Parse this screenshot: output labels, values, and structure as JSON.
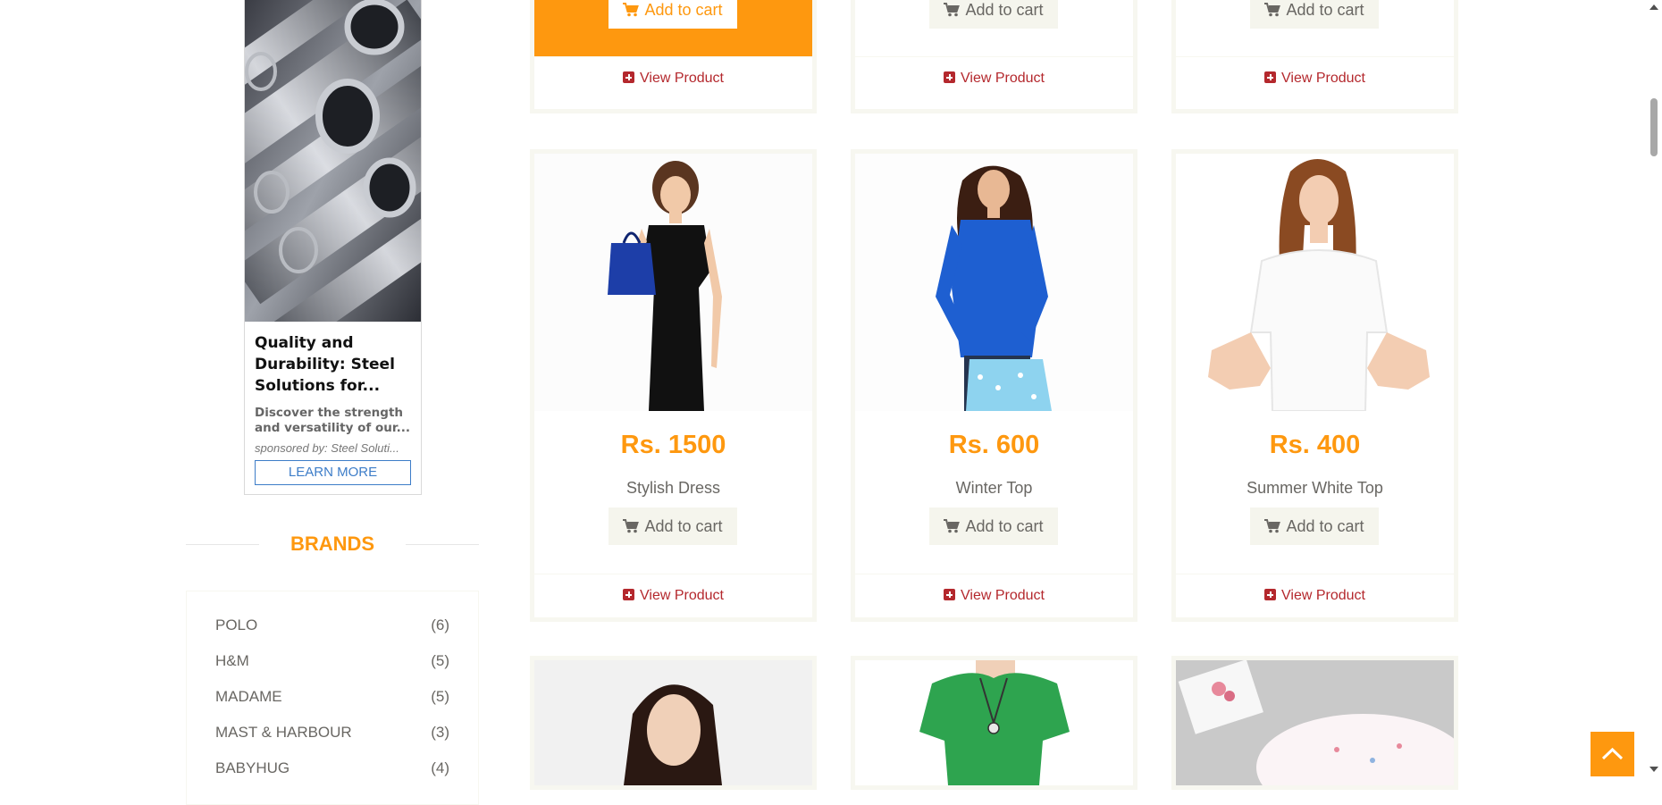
{
  "ad": {
    "title": "Quality and Durability: Steel Solutions for...",
    "desc_line1": "Discover the strength",
    "desc_line2": "and versatility of our...",
    "sponsor": "sponsored by: Steel Soluti...",
    "button": "LEARN MORE"
  },
  "brands": {
    "heading": "BRANDS",
    "items": [
      {
        "name": "POLO",
        "count": "(6)"
      },
      {
        "name": "H&M",
        "count": "(5)"
      },
      {
        "name": "MADAME",
        "count": "(5)"
      },
      {
        "name": "MAST & HARBOUR",
        "count": "(3)"
      },
      {
        "name": "BABYHUG",
        "count": "(4)"
      }
    ]
  },
  "labels": {
    "add_to_cart": "Add to cart",
    "view_product": "View Product"
  },
  "products": [
    {
      "price": "Rs. 1500",
      "name": "Stylish Dress",
      "image": "woman-black-dress-photo"
    },
    {
      "price": "Rs. 600",
      "name": "Winter Top",
      "image": "woman-blue-top-photo"
    },
    {
      "price": "Rs. 400",
      "name": "Summer White Top",
      "image": "girl-white-tshirt-photo"
    }
  ],
  "colors": {
    "accent": "#fe980f",
    "view_link": "#b4282d",
    "ad_button": "#3d7dc8"
  },
  "icons": {
    "cart": "cart-icon",
    "view": "plus-square-icon",
    "scroll_top": "chevron-up-icon"
  }
}
